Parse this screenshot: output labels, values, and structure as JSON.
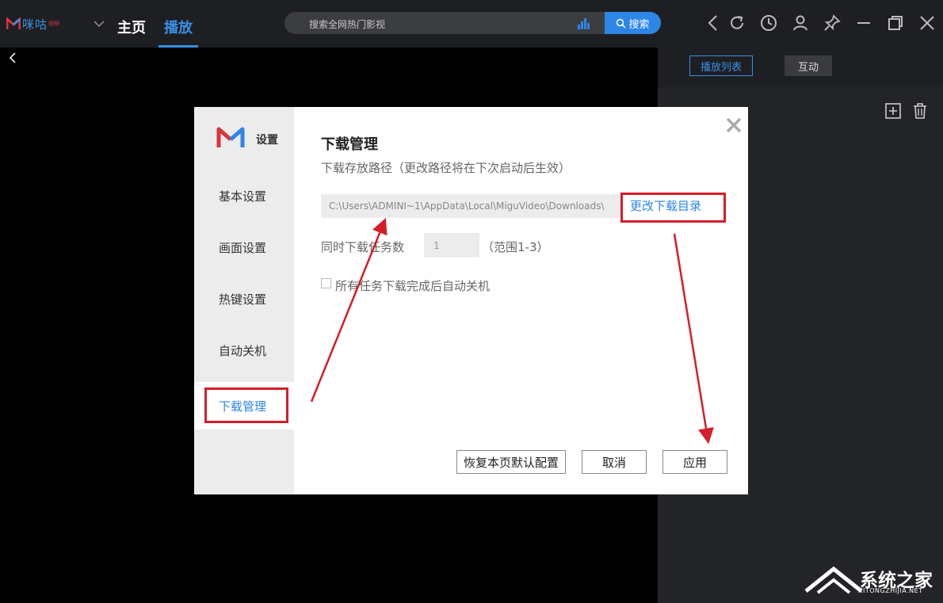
{
  "brand": {
    "logo_text": "咪咕",
    "logo_small": "视频",
    "logo_color": "#d8343c",
    "accent": "#2d86e6"
  },
  "nav": {
    "home": "主页",
    "play": "播放"
  },
  "search": {
    "placeholder": "搜索全网热门影视",
    "button": "搜索"
  },
  "right_panel": {
    "tab_list": "播放列表",
    "tab_interact": "互动"
  },
  "dialog": {
    "title": "设置",
    "sidebar": [
      {
        "label": "基本设置"
      },
      {
        "label": "画面设置"
      },
      {
        "label": "热键设置"
      },
      {
        "label": "自动关机"
      },
      {
        "label": "下载管理",
        "active": true
      }
    ],
    "heading": "下载管理",
    "path_label": "下载存放路径（更改路径将在下次启动后生效）",
    "path_value": "C:\\Users\\ADMINI~1\\AppData\\Local\\MiguVideo\\Downloads\\",
    "change_dir": "更改下载目录",
    "concurrent_label": "同时下载任务数",
    "concurrent_value": "1",
    "concurrent_range": "（范围1-3）",
    "auto_shutdown_label": "所有任务下载完成后自动关机",
    "auto_shutdown_checked": false,
    "reset_button": "恢复本页默认配置",
    "cancel_button": "取消",
    "apply_button": "应用"
  },
  "watermark": {
    "text": "系统之家",
    "url": "XITONGZHIJIA.NET"
  }
}
